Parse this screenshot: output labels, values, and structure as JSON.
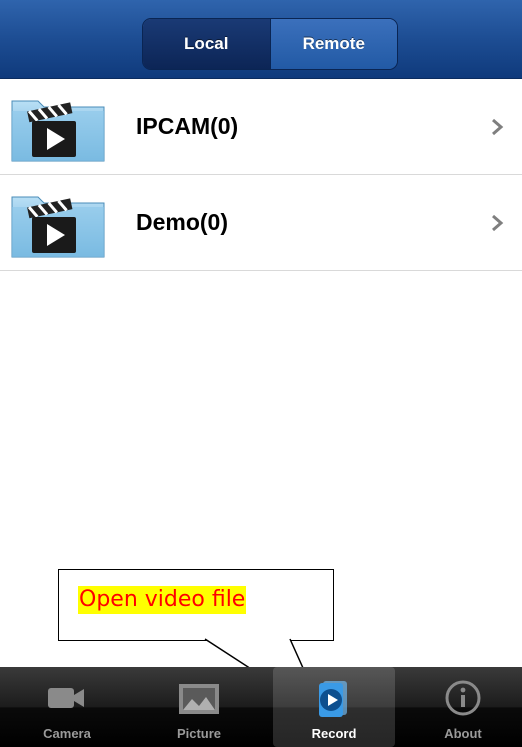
{
  "segmented_control": {
    "local_label": "Local",
    "remote_label": "Remote",
    "selected": "Local"
  },
  "list": {
    "items": [
      {
        "label": "IPCAM(0)",
        "icon": "video-folder-icon"
      },
      {
        "label": "Demo(0)",
        "icon": "video-folder-icon"
      }
    ]
  },
  "callout": {
    "text": "Open video file"
  },
  "tabbar": {
    "tabs": [
      {
        "label": "Camera",
        "icon": "camera-icon"
      },
      {
        "label": "Picture",
        "icon": "picture-icon"
      },
      {
        "label": "Record",
        "icon": "record-icon"
      },
      {
        "label": "About",
        "icon": "info-icon"
      }
    ],
    "selected": "Record"
  },
  "colors": {
    "navbar": "#1d4d93",
    "callout_text": "#ff0000",
    "callout_highlight": "#ffff00",
    "tab_selected_icon": "#2a8fe0"
  }
}
